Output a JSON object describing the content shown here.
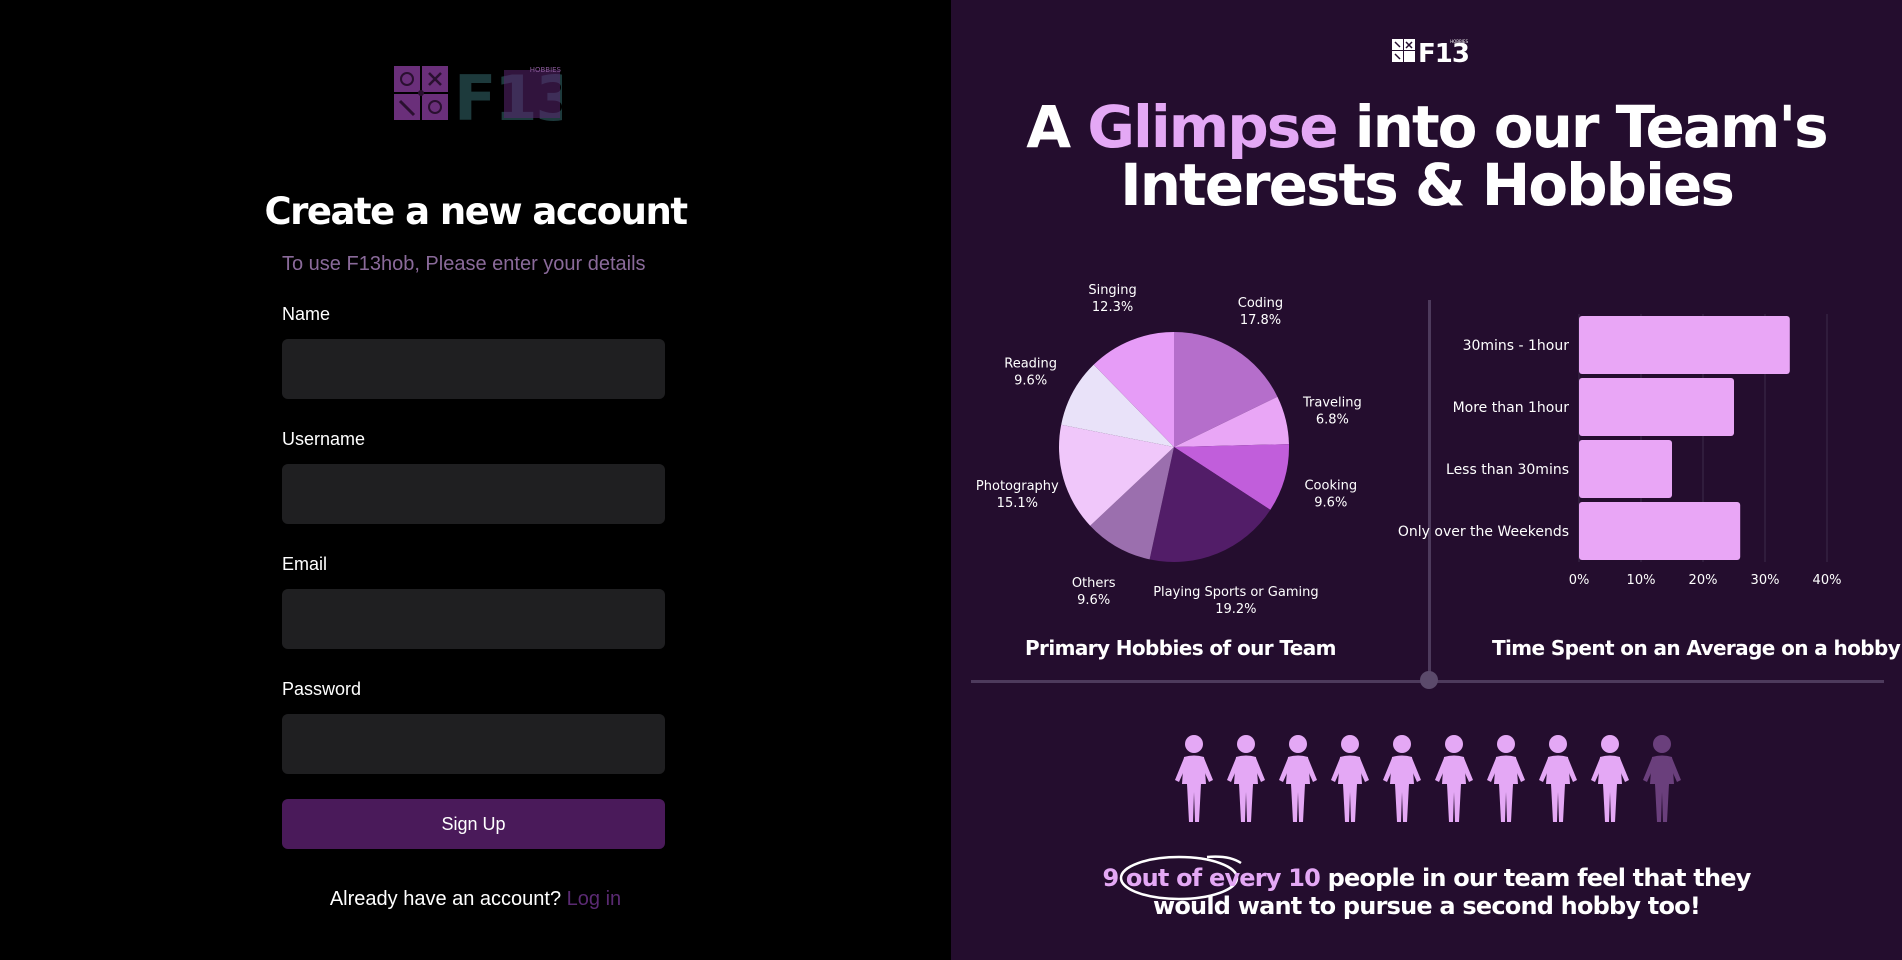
{
  "brand": {
    "name": "F13",
    "tag": "HOBBIES"
  },
  "signup": {
    "title": "Create a new account",
    "subtitle": "To use F13hob, Please enter your details",
    "fields": [
      {
        "label": "Name",
        "value": "",
        "placeholder": ""
      },
      {
        "label": "Username",
        "value": "",
        "placeholder": ""
      },
      {
        "label": "Email",
        "value": "",
        "placeholder": ""
      },
      {
        "label": "Password",
        "value": "",
        "placeholder": ""
      }
    ],
    "button_label": "Sign Up",
    "login_prompt": "Already have an account?",
    "login_link": "Log in"
  },
  "infographic": {
    "headline_part1": "A",
    "headline_accent": "Glimpse",
    "headline_part2": "into our Team's",
    "headline_line2": "Interests & Hobbies",
    "pie_caption": "Primary Hobbies of our Team",
    "bar_caption": "Time Spent on an Average on a hobby",
    "people_highlighted": 9,
    "people_total": 10,
    "stat_accent": "9 out of every 10",
    "stat_line1": "people in our team feel that they",
    "stat_line2": "would want to pursue a second hobby too!"
  },
  "chart_data": [
    {
      "type": "pie",
      "title": "Primary Hobbies of our Team",
      "slices": [
        {
          "label": "Coding",
          "pct_label": "17.8%",
          "value": 17.8,
          "color": "#b56ecb"
        },
        {
          "label": "Traveling",
          "pct_label": "6.8%",
          "value": 6.8,
          "color": "#e9a6f6"
        },
        {
          "label": "Cooking",
          "pct_label": "9.6%",
          "value": 9.6,
          "color": "#c15edb"
        },
        {
          "label": "Playing Sports or Gaming",
          "pct_label": "19.2%",
          "value": 19.2,
          "color": "#521d68"
        },
        {
          "label": "Others",
          "pct_label": "9.6%",
          "value": 9.6,
          "color": "#9b6fae"
        },
        {
          "label": "Photography",
          "pct_label": "15.1%",
          "value": 15.1,
          "color": "#f0c7fa"
        },
        {
          "label": "Reading",
          "pct_label": "9.6%",
          "value": 9.6,
          "color": "#e9e2f9"
        },
        {
          "label": "Singing",
          "pct_label": "12.3%",
          "value": 12.3,
          "color": "#e69cf7"
        }
      ]
    },
    {
      "type": "bar",
      "orientation": "horizontal",
      "title": "Time Spent on an Average on a hobby",
      "categories": [
        "30mins - 1hour",
        "More than 1hour",
        "Less than 30mins",
        "Only over the Weekends"
      ],
      "values": [
        34,
        25,
        15,
        26
      ],
      "xlim": [
        0,
        40
      ],
      "xticks": [
        "0%",
        "10%",
        "20%",
        "30%",
        "40%"
      ],
      "grid": true,
      "color": "#e9a6f6"
    }
  ],
  "colors": {
    "accent": "#e4a8f5",
    "button": "#4a1a5a",
    "input_bg": "#1f1f21",
    "panel_bg": "#240d2e",
    "person_active": "#e4a8f5",
    "person_inactive": "#6a3f7c"
  },
  "icons": [
    "logo-grid-icon",
    "person-icon"
  ]
}
